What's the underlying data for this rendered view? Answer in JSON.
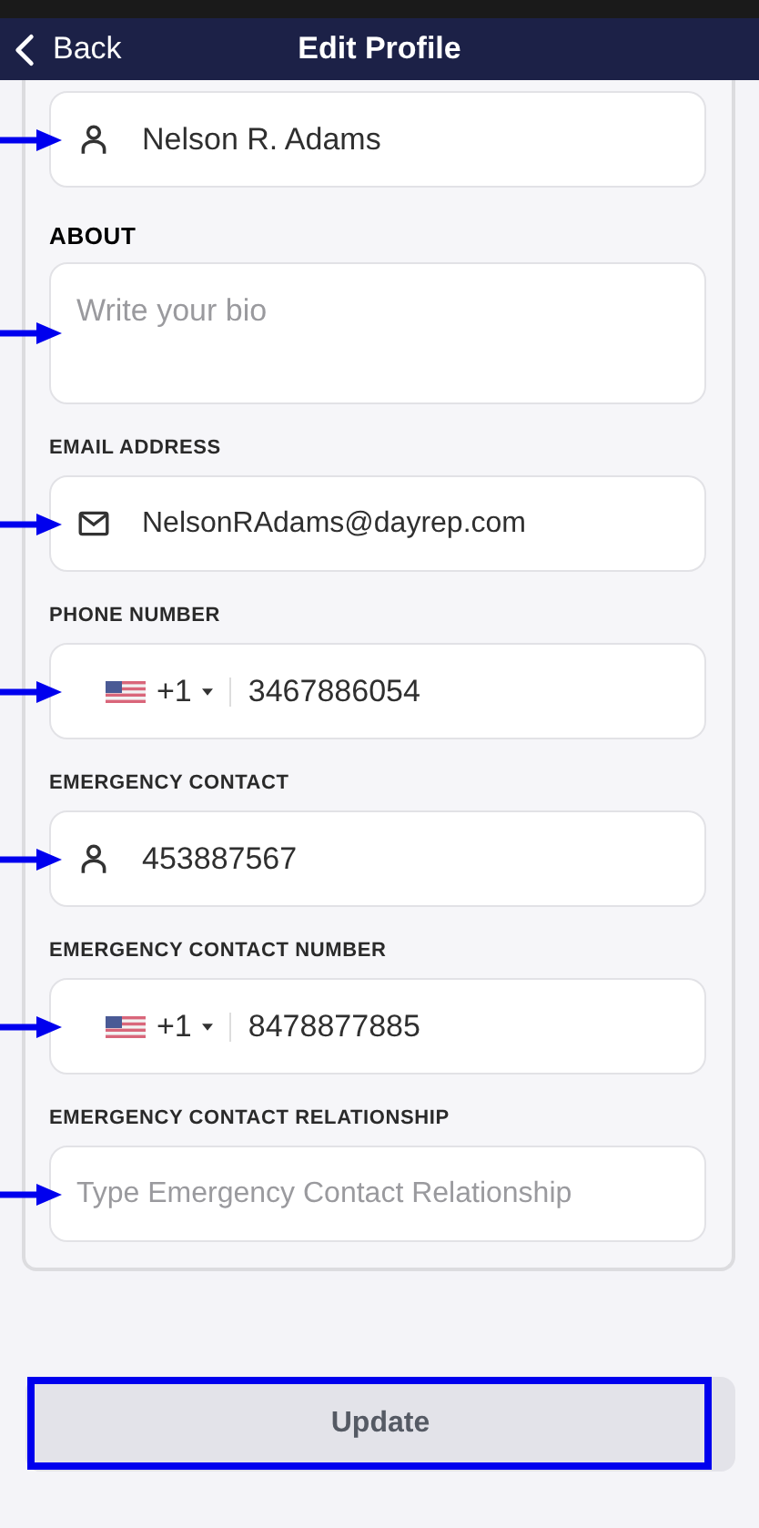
{
  "nav_bar": {
    "back_label": "Back",
    "title": "Edit Profile"
  },
  "fields": [
    {
      "kind": "person",
      "value": "Nelson R. Adams"
    },
    {
      "kind": "textarea",
      "label": "ABOUT",
      "placeholder": "Write your bio"
    },
    {
      "kind": "email",
      "label": "EMAIL ADDRESS",
      "value": "NelsonRAdams@dayrep.com"
    },
    {
      "kind": "phone",
      "label": "PHONE NUMBER",
      "country_code": "+1",
      "value": "3467886054"
    },
    {
      "kind": "person",
      "label": "EMERGENCY CONTACT",
      "value": "453887567"
    },
    {
      "kind": "phone",
      "label": "EMERGENCY CONTACT NUMBER",
      "country_code": "+1",
      "value": "8478877885"
    },
    {
      "kind": "text",
      "label": "EMERGENCY CONTACT RELATIONSHIP",
      "placeholder": "Type Emergency Contact Relationship"
    }
  ],
  "submit": {
    "label": "Update",
    "disabled": true
  }
}
